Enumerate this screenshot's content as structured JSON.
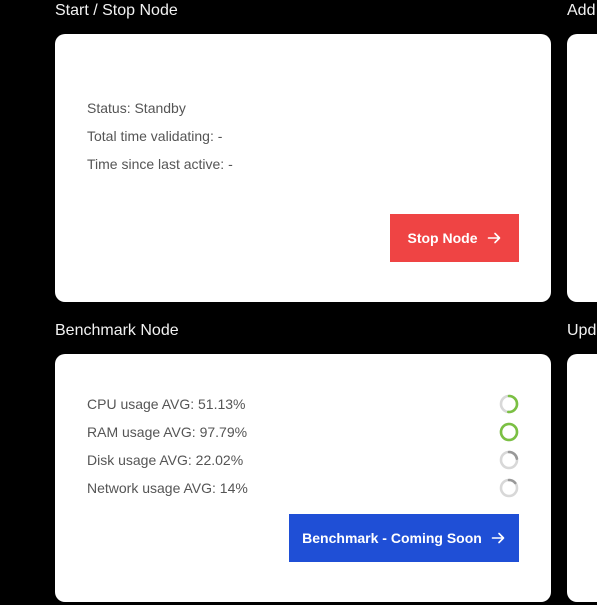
{
  "sections": {
    "start_stop": {
      "title": "Start / Stop Node",
      "status": "Status: Standby",
      "total_time": "Total time validating: -",
      "time_since": "Time since last active: -",
      "button_label": "Stop Node",
      "button_color": "#ef4444"
    },
    "benchmark": {
      "title": "Benchmark Node",
      "metrics": [
        {
          "label": "CPU usage AVG: 51.13%",
          "value": 51.13,
          "color": "#7bc043"
        },
        {
          "label": "RAM usage AVG: 97.79%",
          "value": 97.79,
          "color": "#7bc043"
        },
        {
          "label": "Disk usage AVG: 22.02%",
          "value": 22.02,
          "color": "#999999"
        },
        {
          "label": "Network usage AVG: 14%",
          "value": 14,
          "color": "#999999"
        }
      ],
      "button_label": "Benchmark - Coming Soon",
      "button_color": "#1f4fd6"
    },
    "right_top": {
      "title_partial": "Add"
    },
    "right_bottom": {
      "title_partial": "Upd"
    }
  },
  "colors": {
    "page_background": "#000000",
    "card_background": "#ffffff",
    "text_muted": "#555555",
    "gauge_track": "#d8d8d8"
  },
  "icons": {
    "button_arrow": "arrow-right-icon",
    "gauge": "progress-ring-icon"
  }
}
